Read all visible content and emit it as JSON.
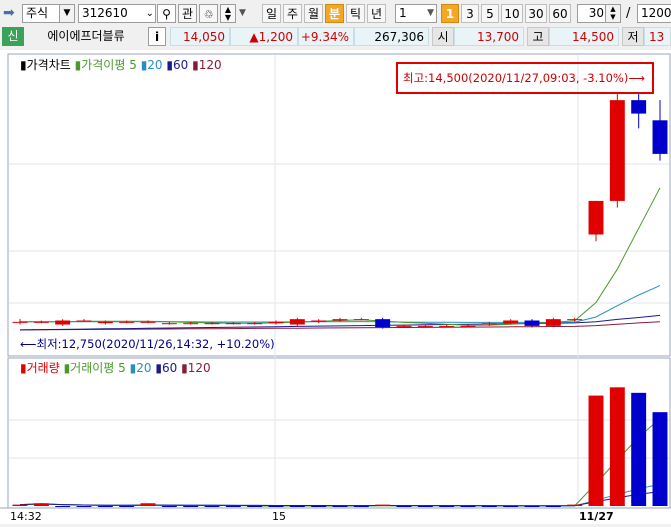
{
  "toolbar": {
    "market": "주식",
    "code": "312610",
    "watch_label": "관",
    "periods": [
      "일",
      "주",
      "월",
      "분",
      "틱",
      "년"
    ],
    "active_period": "분",
    "interval_value": "1",
    "interval_buttons": [
      "1",
      "3",
      "5",
      "10",
      "30",
      "60"
    ],
    "active_interval": "1",
    "count_value": "30",
    "slash": "/",
    "count_total": "1200"
  },
  "quote": {
    "badge": "신",
    "name": "에이에프더블류",
    "info_label": "i",
    "price": "14,050",
    "change": "▲1,200",
    "change_pct": "+9.34%",
    "volume": "267,306",
    "open_label": "시",
    "open": "13,700",
    "high_label": "고",
    "high": "14,500",
    "low_label": "저",
    "low": "13"
  },
  "price_panel": {
    "legend_title": "가격차트",
    "ma_title": "가격이평",
    "ma_periods": [
      "5",
      "20",
      "60",
      "120"
    ],
    "high_annotation": "최고:14,500(2020/11/27,09:03, -3.10%)⟶",
    "low_annotation": "⟵최저:12,750(2020/11/26,14:32, +10.20%)"
  },
  "volume_panel": {
    "legend_title": "거래량",
    "ma_title": "거래이평",
    "ma_periods": [
      "5",
      "20",
      "60",
      "120"
    ]
  },
  "x_axis": {
    "labels": [
      "14:32",
      "15",
      "11/27"
    ]
  },
  "colors": {
    "up": "#e00000",
    "down": "#0000cc",
    "ma5": "#4a9a2a",
    "ma20": "#2a8fc0",
    "ma60": "#1a1a8a",
    "ma120": "#8a1a3a",
    "highlight_box": "#e00000",
    "active_period": "#f5a623"
  },
  "chart_data": {
    "type": "candlestick",
    "price_high": 14500,
    "price_low": 12750,
    "candles": [
      {
        "o": 12800,
        "h": 12820,
        "l": 12780,
        "c": 12800
      },
      {
        "o": 12800,
        "h": 12810,
        "l": 12790,
        "c": 12800
      },
      {
        "o": 12780,
        "h": 12820,
        "l": 12770,
        "c": 12810
      },
      {
        "o": 12810,
        "h": 12820,
        "l": 12800,
        "c": 12810
      },
      {
        "o": 12790,
        "h": 12810,
        "l": 12780,
        "c": 12800
      },
      {
        "o": 12800,
        "h": 12810,
        "l": 12790,
        "c": 12800
      },
      {
        "o": 12800,
        "h": 12810,
        "l": 12790,
        "c": 12800
      },
      {
        "o": 12790,
        "h": 12800,
        "l": 12780,
        "c": 12790
      },
      {
        "o": 12790,
        "h": 12800,
        "l": 12780,
        "c": 12790
      },
      {
        "o": 12790,
        "h": 12800,
        "l": 12780,
        "c": 12790
      },
      {
        "o": 12790,
        "h": 12800,
        "l": 12780,
        "c": 12790
      },
      {
        "o": 12790,
        "h": 12800,
        "l": 12780,
        "c": 12790
      },
      {
        "o": 12790,
        "h": 12810,
        "l": 12780,
        "c": 12800
      },
      {
        "o": 12780,
        "h": 12830,
        "l": 12770,
        "c": 12820
      },
      {
        "o": 12800,
        "h": 12820,
        "l": 12790,
        "c": 12810
      },
      {
        "o": 12810,
        "h": 12830,
        "l": 12800,
        "c": 12820
      },
      {
        "o": 12820,
        "h": 12830,
        "l": 12810,
        "c": 12820
      },
      {
        "o": 12820,
        "h": 12830,
        "l": 12750,
        "c": 12760
      },
      {
        "o": 12770,
        "h": 12780,
        "l": 12760,
        "c": 12770
      },
      {
        "o": 12770,
        "h": 12780,
        "l": 12760,
        "c": 12770
      },
      {
        "o": 12770,
        "h": 12780,
        "l": 12760,
        "c": 12770
      },
      {
        "o": 12770,
        "h": 12780,
        "l": 12760,
        "c": 12770
      },
      {
        "o": 12780,
        "h": 12800,
        "l": 12770,
        "c": 12790
      },
      {
        "o": 12790,
        "h": 12820,
        "l": 12780,
        "c": 12810
      },
      {
        "o": 12810,
        "h": 12820,
        "l": 12760,
        "c": 12770
      },
      {
        "o": 12770,
        "h": 12830,
        "l": 12760,
        "c": 12820
      },
      {
        "o": 12820,
        "h": 12830,
        "l": 12800,
        "c": 12820
      },
      {
        "o": 13450,
        "h": 13700,
        "l": 13400,
        "c": 13700
      },
      {
        "o": 13700,
        "h": 14500,
        "l": 13650,
        "c": 14450
      },
      {
        "o": 14450,
        "h": 14500,
        "l": 14240,
        "c": 14350
      },
      {
        "o": 14300,
        "h": 14450,
        "l": 14000,
        "c": 14050
      }
    ],
    "volume_max": 100,
    "volumes": [
      1,
      2,
      0,
      0,
      0,
      0,
      2,
      0,
      0,
      0,
      0,
      0,
      0,
      0,
      0,
      0,
      0,
      1,
      0,
      0,
      0,
      0,
      0,
      0,
      0,
      0,
      1,
      80,
      86,
      82,
      68
    ],
    "volume_up": [
      true,
      true,
      false,
      false,
      false,
      false,
      true,
      false,
      false,
      false,
      false,
      false,
      false,
      false,
      false,
      false,
      false,
      true,
      false,
      false,
      false,
      false,
      false,
      false,
      false,
      false,
      true,
      true,
      true,
      false,
      false
    ],
    "ma5": [
      12800,
      12800,
      12800,
      12805,
      12805,
      12805,
      12805,
      12800,
      12795,
      12792,
      12790,
      12790,
      12792,
      12798,
      12804,
      12810,
      12816,
      12806,
      12796,
      12790,
      12782,
      12774,
      12776,
      12782,
      12790,
      12796,
      12808,
      12944,
      13192,
      13496,
      13798
    ],
    "ma20": [
      12800,
      12800,
      12800,
      12801,
      12801,
      12801,
      12801,
      12800,
      12800,
      12799,
      12799,
      12799,
      12799,
      12800,
      12801,
      12801,
      12802,
      12800,
      12798,
      12797,
      12797,
      12796,
      12796,
      12796,
      12796,
      12796,
      12797,
      12836,
      12920,
      13000,
      13070
    ],
    "ma60": [
      12740,
      12742,
      12744,
      12746,
      12748,
      12750,
      12752,
      12754,
      12756,
      12758,
      12760,
      12762,
      12764,
      12766,
      12768,
      12770,
      12772,
      12774,
      12776,
      12778,
      12780,
      12782,
      12784,
      12786,
      12788,
      12790,
      12792,
      12800,
      12818,
      12832,
      12848
    ],
    "ma120": [
      12740,
      12741,
      12742,
      12743,
      12744,
      12745,
      12746,
      12747,
      12748,
      12749,
      12750,
      12751,
      12752,
      12753,
      12754,
      12755,
      12756,
      12757,
      12758,
      12759,
      12760,
      12761,
      12762,
      12763,
      12764,
      12765,
      12766,
      12772,
      12782,
      12792,
      12800
    ]
  }
}
